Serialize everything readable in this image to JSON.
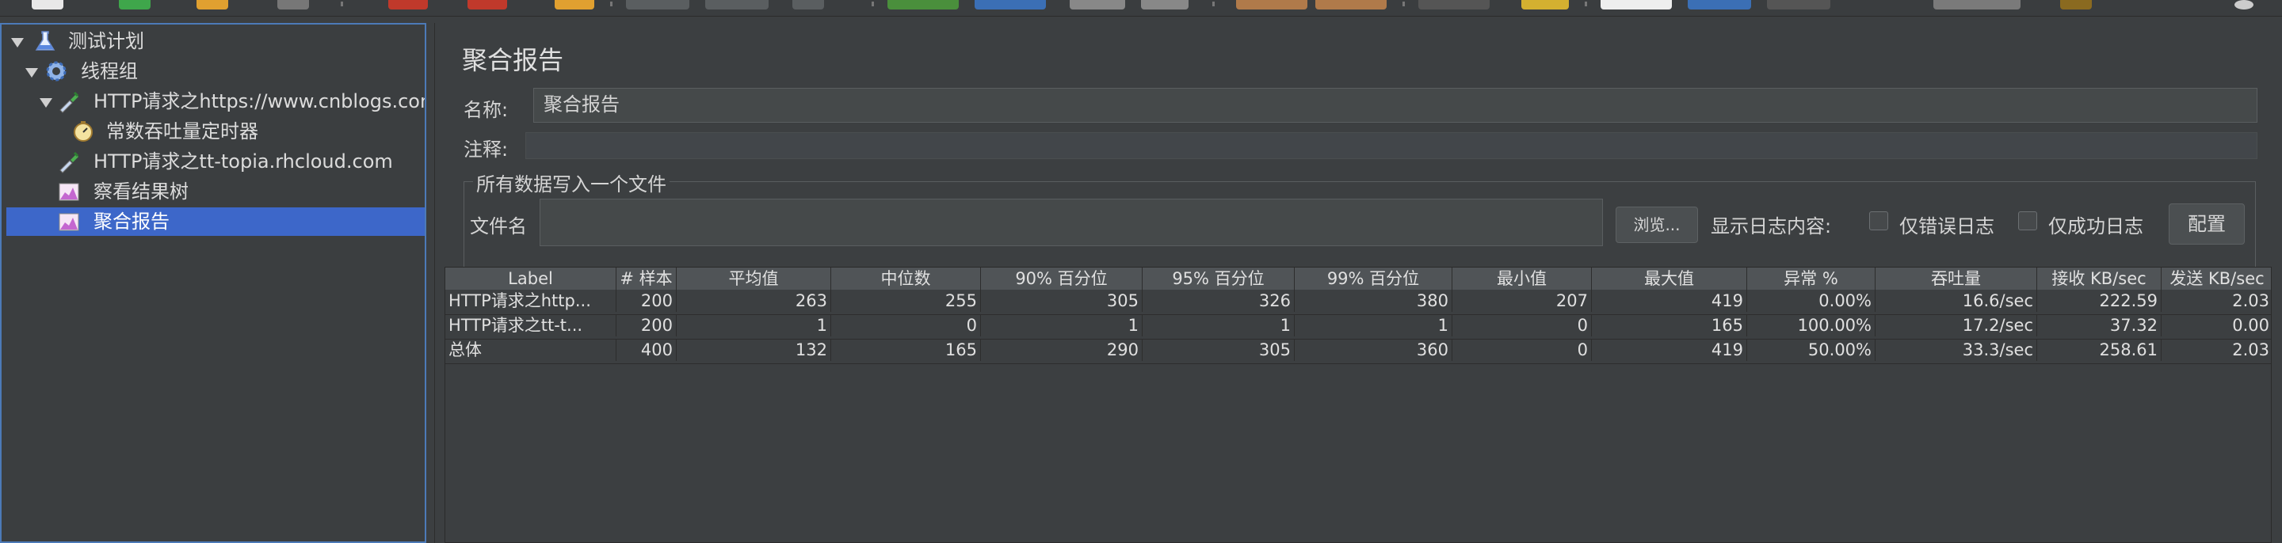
{
  "colors": {
    "background": "#3c3f41",
    "selection": "#3d67c9",
    "tree_border": "#4c7ab8"
  },
  "tree": {
    "items": [
      {
        "label": "测试计划",
        "icon": "flask-icon"
      },
      {
        "label": "线程组",
        "icon": "gear-icon"
      },
      {
        "label": "HTTP请求之https://www.cnblogs.com",
        "icon": "pipette-icon"
      },
      {
        "label": "常数吞吐量定时器",
        "icon": "timer-icon"
      },
      {
        "label": "HTTP请求之tt-topia.rhcloud.com",
        "icon": "pipette-icon"
      },
      {
        "label": "察看结果树",
        "icon": "chart-icon"
      },
      {
        "label": "聚合报告",
        "icon": "chart-icon"
      }
    ]
  },
  "panel": {
    "title": "聚合报告",
    "name_label": "名称:",
    "name_value": "聚合报告",
    "comment_label": "注释:",
    "comment_value": "",
    "file_group_title": "所有数据写入一个文件",
    "file_label": "文件名",
    "file_value": "",
    "browse_label": "浏览...",
    "log_label": "显示日志内容:",
    "errors_only_label": "仅错误日志",
    "success_only_label": "仅成功日志",
    "config_label": "配置"
  },
  "table": {
    "headers": [
      "Label",
      "# 样本",
      "平均值",
      "中位数",
      "90% 百分位",
      "95% 百分位",
      "99% 百分位",
      "最小值",
      "最大值",
      "异常 %",
      "吞吐量",
      "接收 KB/sec",
      "发送 KB/sec"
    ],
    "rows": [
      [
        "HTTP请求之http...",
        "200",
        "263",
        "255",
        "305",
        "326",
        "380",
        "207",
        "419",
        "0.00%",
        "16.6/sec",
        "222.59",
        "2.03"
      ],
      [
        "HTTP请求之tt-t...",
        "200",
        "1",
        "0",
        "1",
        "1",
        "1",
        "0",
        "165",
        "100.00%",
        "17.2/sec",
        "37.32",
        "0.00"
      ],
      [
        "总体",
        "400",
        "132",
        "165",
        "290",
        "305",
        "360",
        "0",
        "419",
        "50.00%",
        "33.3/sec",
        "258.61",
        "2.03"
      ]
    ]
  }
}
